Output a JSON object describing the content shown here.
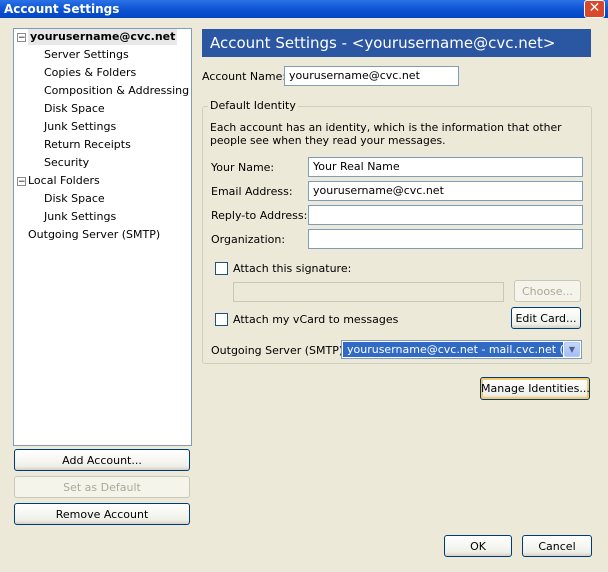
{
  "window": {
    "title": "Account Settings",
    "close_glyph": "✕"
  },
  "tree": {
    "account": {
      "label": "yourusername@cvc.net",
      "children": [
        "Server Settings",
        "Copies & Folders",
        "Composition & Addressing",
        "Disk Space",
        "Junk Settings",
        "Return Receipts",
        "Security"
      ]
    },
    "local_folders": {
      "label": "Local Folders",
      "children": [
        "Disk Space",
        "Junk Settings"
      ]
    },
    "outgoing_server": "Outgoing Server (SMTP)"
  },
  "buttons": {
    "add_account": "Add Account...",
    "set_default": "Set as Default",
    "remove_account": "Remove Account",
    "manage_identities": "Manage Identities...",
    "choose": "Choose...",
    "edit_card": "Edit Card...",
    "ok": "OK",
    "cancel": "Cancel"
  },
  "panel": {
    "header": "Account Settings - <yourusername@cvc.net>",
    "account_name_label": "Account Name:",
    "account_name_value": "yourusername@cvc.net",
    "identity_legend": "Default Identity",
    "identity_desc": "Each account has an identity, which is the information that other people see when they read your messages.",
    "your_name_label": "Your Name:",
    "your_name_value": "Your Real Name",
    "email_label": "Email Address:",
    "email_value": "yourusername@cvc.net",
    "reply_to_label": "Reply-to Address:",
    "reply_to_value": "",
    "organization_label": "Organization:",
    "organization_value": "",
    "attach_signature_label": "Attach this signature:",
    "attach_signature_checked": false,
    "signature_path": "",
    "attach_vcard_label": "Attach my vCard to messages",
    "attach_vcard_checked": false,
    "smtp_label": "Outgoing Server (SMTP):",
    "smtp_value": "yourusername@cvc.net - mail.cvc.net (Default)"
  },
  "colors": {
    "titlebar": "#0a50d0",
    "header_bg": "#2a56a2",
    "selection": "#316ac5",
    "window_bg": "#ece9d8"
  }
}
